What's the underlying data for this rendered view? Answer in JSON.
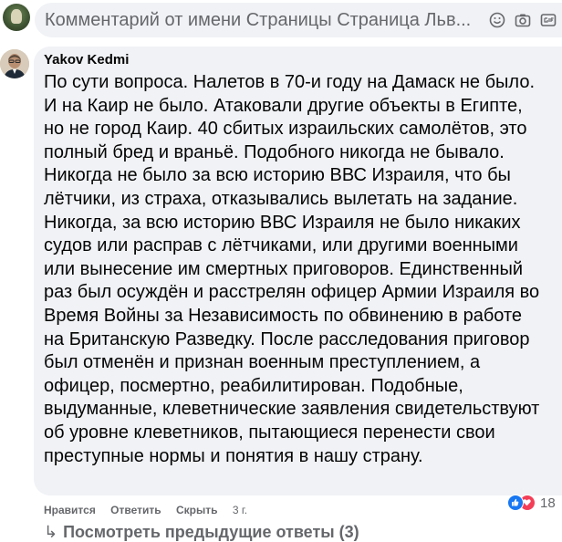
{
  "composer": {
    "placeholder": "Комментарий от имени Страницы Страница Льв...",
    "icons": [
      "emoji-icon",
      "camera-icon",
      "gif-icon"
    ]
  },
  "comment": {
    "author": "Yakov Kedmi",
    "lines": [
      "По сути вопроса. Налетов в 70-и году на Дамаск не было.",
      "И на Каир не было. Атаковали другие объекты в Египте,",
      "но не город Каир. 40 сбитых израильских самолётов, это",
      "полный бред и враньё. Подобного никогда не бывало.",
      "Никогда не было за всю историю ВВС Израиля, что бы",
      "лётчики, из страха, отказывались вылетать на задание.",
      "Никогда, за всю историю ВВС Израиля не было никаких",
      "судов или расправ с лётчиками, или другими военными",
      "или вынесение им смертных приговоров. Единственный",
      "раз был осуждён и расстрелян офицер Армии Израиля во",
      "Время Войны за Независимость по обвинению в работе",
      "на Британскую Разведку. После расследования приговор",
      "был отменён и признан военным преступлением, а",
      "офицер, посмертно, реабилитирован. Подобные,",
      "выдуманные, клеветнические заявления свидетельствуют",
      "об уровне клеветников, пытающиеся перенести свои",
      "преступные нормы и понятия в нашу страну."
    ],
    "actions": {
      "like": "Нравится",
      "reply": "Ответить",
      "hide": "Скрыть",
      "time": "3 г."
    },
    "reactions": {
      "icons": [
        "like-icon",
        "love-icon"
      ],
      "count": "18"
    }
  },
  "more_replies": {
    "arrow": "↳",
    "label": "Посмотреть предыдущие ответы (3)"
  },
  "colors": {
    "bubble": "#f0f2f5",
    "secondary_text": "#65676b",
    "like_blue": "#1877f2",
    "love_red": "#f33e58"
  }
}
